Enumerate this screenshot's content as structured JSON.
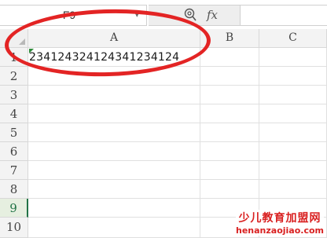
{
  "formula_bar": {
    "name_box": "F9",
    "name_box_arrow": "▾",
    "fx_label": "fx",
    "formula_value": ""
  },
  "sheet": {
    "columns": [
      "A",
      "B",
      "C"
    ],
    "rows": [
      "1",
      "2",
      "3",
      "4",
      "5",
      "6",
      "7",
      "8",
      "9",
      "10"
    ],
    "selected_row": "9",
    "cells": {
      "A1": "234124324124341234124"
    }
  },
  "annotation": {
    "color": "#e32424"
  },
  "watermark": {
    "line1": "少儿教育加盟网",
    "line2": "henanzaojiao.com"
  }
}
